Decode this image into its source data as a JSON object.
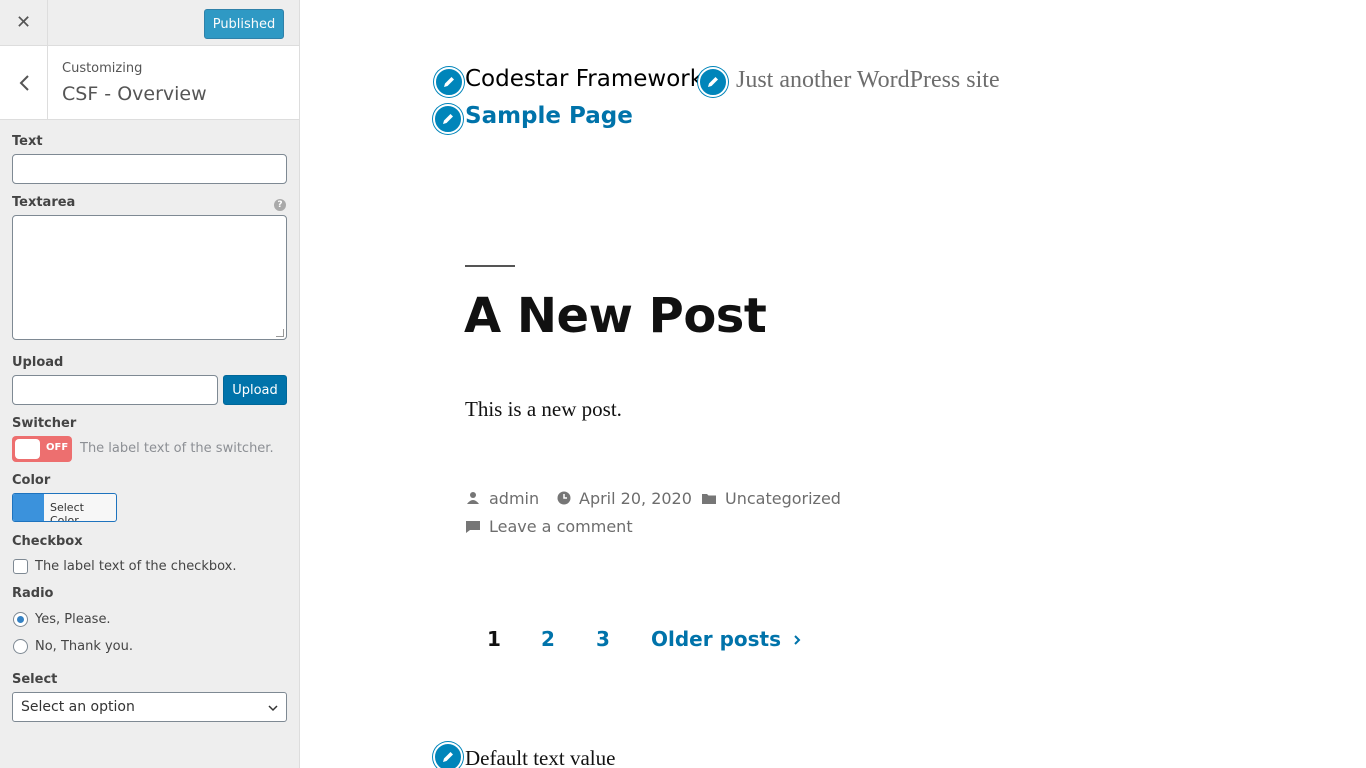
{
  "sidebar": {
    "close_icon": "close-icon",
    "publish_label": "Published",
    "customizing_label": "Customizing",
    "section_title": "CSF - Overview"
  },
  "controls": {
    "text": {
      "label": "Text",
      "value": ""
    },
    "textarea": {
      "label": "Textarea",
      "value": "",
      "help": "?"
    },
    "upload": {
      "label": "Upload",
      "value": "",
      "button": "Upload"
    },
    "switcher": {
      "label": "Switcher",
      "state": "OFF",
      "description": "The label text of the switcher."
    },
    "color": {
      "label": "Color",
      "button": "Select Color",
      "swatch": "#3b92dc"
    },
    "checkbox": {
      "label": "Checkbox",
      "option": "The label text of the checkbox.",
      "checked": false
    },
    "radio": {
      "label": "Radio",
      "options": [
        {
          "label": "Yes, Please.",
          "checked": true
        },
        {
          "label": "No, Thank you.",
          "checked": false
        }
      ]
    },
    "select": {
      "label": "Select",
      "value": "Select an option"
    }
  },
  "preview": {
    "site_title": "Codestar Framework",
    "tagline": "Just another WordPress site",
    "menu_item": "Sample Page",
    "post_title": "A New Post",
    "post_body": "This is a new post.",
    "meta": {
      "author": "admin",
      "date": "April 20, 2020",
      "category": "Uncategorized",
      "comments": "Leave a comment"
    },
    "pagination": {
      "pages": [
        "1",
        "2",
        "3"
      ],
      "current": "1",
      "older": "Older posts"
    },
    "footer_text": "Default text value"
  },
  "colors": {
    "accent": "#0073aa",
    "switch_off": "#ed6f6f",
    "shortcut": "#0085ba"
  }
}
